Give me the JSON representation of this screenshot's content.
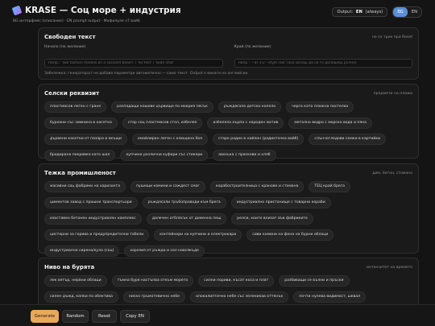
{
  "header": {
    "title": "KRASE — Соц море + индустрия",
    "subtitle": "BG интерфейс (описание) · EN prompt output · Мофилуле v7 вайб",
    "output_label": "Output:",
    "output_value": "EN",
    "output_suffix": "(always)",
    "lang_bg": "BG",
    "lang_en": "EN"
  },
  "free_text": {
    "title": "Свободен текст",
    "note_right": "не се триe при Reset",
    "start_label": "Начало (по желание)",
    "start_placeholder": "Напр.: 'Two fashion models on a socialist beach' / 'no text' / 'wide shot'",
    "end_label": "Край (по желание)",
    "end_placeholder": "Напр.: '--ar 3:2 --style raw' (ако искаш да си го допишеш ръчно)",
    "footnote": "Забележка: генераторът не добавя параметри автоматично — само текст. Output е винаги на английски."
  },
  "village": {
    "title": "Селски реквизит",
    "note_right": "предмети на плажа",
    "chips": [
      "пластмасов леген с гране",
      "разпадащи кошове цървище по мокрия пясък",
      "ръждясало детско колело",
      "черга като плажна постелка",
      "буркани със зимнина в касетка",
      "стар соц пластмасов стол, избелял",
      "избеляла кърпа с народен мотив",
      "метално ведро с морска вода и пяна",
      "дървени касетки от пазара и вкъщи",
      "емайлиран леген с олющена боя",
      "старо радио в найлон (радиоточка вайб)",
      "слънчогледови семки в картийки",
      "бродирана покривка като шал",
      "купчина различни куфари със стикери",
      "авоська с праскови и хляб"
    ]
  },
  "industry": {
    "title": "Тежка промишленост",
    "note_right": "дим, бетон, стомана",
    "chips": [
      "масивни соц фабрики на хоризонта",
      "пушещи комини и саждест смог",
      "корабостроителница с кранове и стомана",
      "ТЕЦ край брега",
      "циментов завод с прашни транспортьори",
      "ръждясали тръбопроводи към брега",
      "индустриално пристанище с товарни кораби",
      "изоставен бетонен индустриален комплекс",
      "далечен отблясък от доменна пещ",
      "релси, които влизат във фабриките",
      "цистерни за горива и предупредителни табели",
      "контейнери на купчини и електрокари",
      "сиви комини на фона на бурни облаци",
      "индустриална сирена/кула (соц)",
      "хорозия от ръжда и сол навсякъде"
    ]
  },
  "storm": {
    "title": "Ниво на бурята",
    "note_right": "интензитет на времето",
    "chips": [
      "лек вятър, нервни облаци",
      "тъмна буря настъпва откъм морето",
      "силни пориви, късат коса и плат",
      "разбиващи се вълни и пръски",
      "силен дъжд, капки по обектива",
      "ниско гръмотевично небе",
      "апокалиптично небе със зеленикав оттенък",
      "почти нулева видимост, шквал"
    ]
  },
  "footer": {
    "generate": "Generate",
    "random": "Random",
    "reset": "Reset",
    "copy": "Copy EN"
  }
}
